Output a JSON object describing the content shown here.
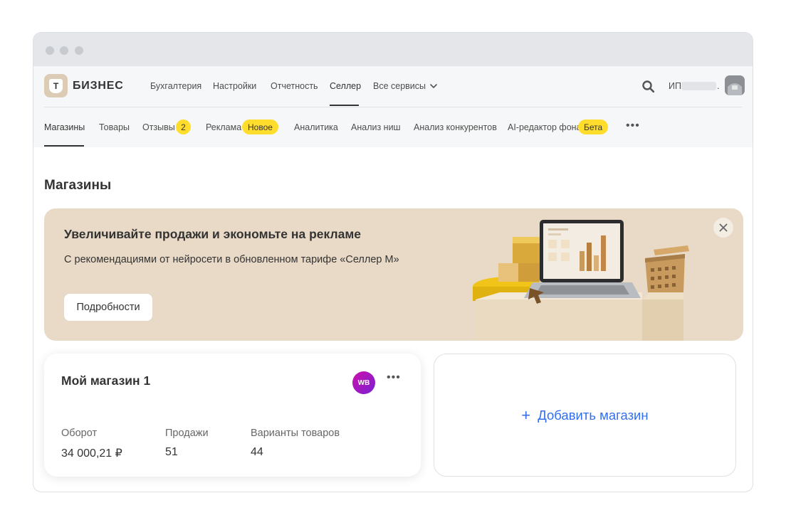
{
  "brand": {
    "logo_letter": "Т",
    "name": "БИЗНЕС"
  },
  "top_nav": {
    "items": [
      "Бухгалтерия",
      "Настройки",
      "Отчетность",
      "Селлер",
      "Все сервисы"
    ],
    "active": "Селлер",
    "account_label": "ИП",
    "account_suffix": "."
  },
  "sub_nav": {
    "items": [
      {
        "label": "Магазины"
      },
      {
        "label": "Товары"
      },
      {
        "label": "Отзывы",
        "badge": "2"
      },
      {
        "label": "Реклама",
        "badge": "Новое"
      },
      {
        "label": "Аналитика"
      },
      {
        "label": "Анализ ниш"
      },
      {
        "label": "Анализ конкурентов"
      },
      {
        "label": "AI-редактор фона",
        "badge": "Бета"
      }
    ],
    "active": "Магазины",
    "more": "•••"
  },
  "page": {
    "title": "Магазины"
  },
  "promo": {
    "title": "Увеличивайте продажи и экономьте на рекламе",
    "subtitle": "С рекомендациями от нейросети в обновленном тарифе «Селлер М»",
    "button": "Подробности"
  },
  "store": {
    "name": "Мой магазин 1",
    "marketplace": "WB",
    "more": "•••",
    "stats": [
      {
        "label": "Оборот",
        "value": "34 000,21 ₽"
      },
      {
        "label": "Продажи",
        "value": "51"
      },
      {
        "label": "Варианты товаров",
        "value": "44"
      }
    ]
  },
  "add_store": {
    "icon": "+",
    "label": "Добавить магазин"
  },
  "colors": {
    "accent_yellow": "#ffdd2d",
    "link_blue": "#336fee",
    "promo_bg": "#e8dac6",
    "wb_purple": "#cb11ab"
  }
}
